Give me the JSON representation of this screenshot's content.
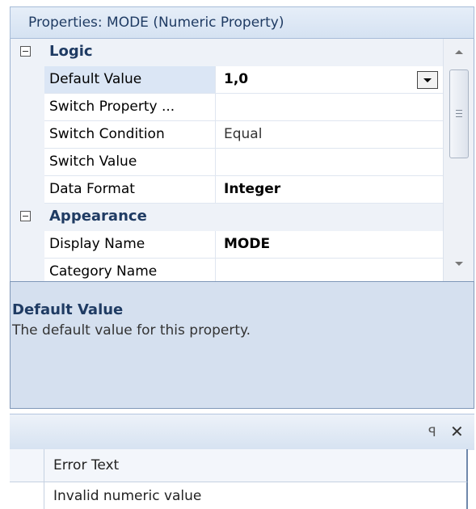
{
  "panel": {
    "title": "Properties: MODE (Numeric Property)"
  },
  "grid": {
    "categories": [
      {
        "label": "Logic",
        "rows": [
          {
            "name": "Default Value",
            "value": "1,0",
            "selected": true
          },
          {
            "name": "Switch Property ...",
            "value": ""
          },
          {
            "name": "Switch Condition",
            "value": "Equal"
          },
          {
            "name": "Switch Value",
            "value": ""
          },
          {
            "name": "Data Format",
            "value": "Integer"
          }
        ]
      },
      {
        "label": "Appearance",
        "rows": [
          {
            "name": "Display Name",
            "value": "MODE"
          },
          {
            "name": "Category Name",
            "value": ""
          }
        ]
      }
    ]
  },
  "description": {
    "title": "Default Value",
    "text": "The default value for this property."
  },
  "error_list": {
    "column_header": "Error Text",
    "rows": [
      {
        "text": "Invalid numeric value"
      }
    ]
  },
  "icons": {
    "collapse": "minus-box-icon",
    "dropdown": "chevron-down-icon",
    "pin": "pin-icon",
    "close": "close-icon",
    "scroll_up": "arrow-up-icon",
    "scroll_down": "arrow-down-icon"
  },
  "colors": {
    "accent": "#1f3b63",
    "selection": "#dbe6f5",
    "description_bg": "#d5e0ef"
  }
}
